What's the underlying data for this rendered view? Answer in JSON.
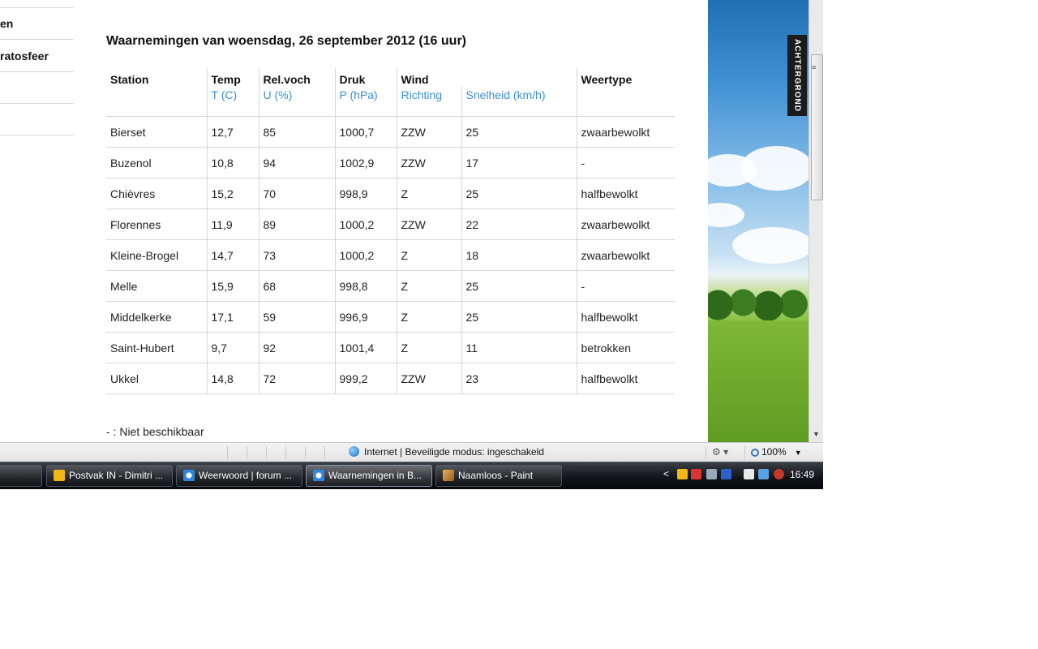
{
  "nav": {
    "items": [
      {
        "label": "en"
      },
      {
        "label": "ratosfeer"
      }
    ]
  },
  "observations": {
    "title": "Waarnemingen van woensdag, 26 september 2012 (16 uur)",
    "headers": {
      "station": "Station",
      "temp": "Temp",
      "temp_unit": "T (C)",
      "humidity": "Rel.voch",
      "humidity_unit": "U (%)",
      "pressure": "Druk",
      "pressure_unit": "P (hPa)",
      "wind": "Wind",
      "wind_dir": "Richting",
      "wind_speed": "Snelheid (km/h)",
      "weather": "Weertype"
    },
    "rows": [
      {
        "station": "Bierset",
        "temp": "12,7",
        "humidity": "85",
        "pressure": "1000,7",
        "direction": "ZZW",
        "speed": "25",
        "weather": "zwaarbewolkt"
      },
      {
        "station": "Buzenol",
        "temp": "10,8",
        "humidity": "94",
        "pressure": "1002,9",
        "direction": "ZZW",
        "speed": "17",
        "weather": "-"
      },
      {
        "station": "Chièvres",
        "temp": "15,2",
        "humidity": "70",
        "pressure": "998,9",
        "direction": "Z",
        "speed": "25",
        "weather": "halfbewolkt"
      },
      {
        "station": "Florennes",
        "temp": "11,9",
        "humidity": "89",
        "pressure": "1000,2",
        "direction": "ZZW",
        "speed": "22",
        "weather": "zwaarbewolkt"
      },
      {
        "station": "Kleine-Brogel",
        "temp": "14,7",
        "humidity": "73",
        "pressure": "1000,2",
        "direction": "Z",
        "speed": "18",
        "weather": "zwaarbewolkt"
      },
      {
        "station": "Melle",
        "temp": "15,9",
        "humidity": "68",
        "pressure": "998,8",
        "direction": "Z",
        "speed": "25",
        "weather": "-"
      },
      {
        "station": "Middelkerke",
        "temp": "17,1",
        "humidity": "59",
        "pressure": "996,9",
        "direction": "Z",
        "speed": "25",
        "weather": "halfbewolkt"
      },
      {
        "station": "Saint-Hubert",
        "temp": "9,7",
        "humidity": "92",
        "pressure": "1001,4",
        "direction": "Z",
        "speed": "11",
        "weather": "betrokken"
      },
      {
        "station": "Ukkel",
        "temp": "14,8",
        "humidity": "72",
        "pressure": "999,2",
        "direction": "ZZW",
        "speed": "23",
        "weather": "halfbewolkt"
      }
    ],
    "note": "- : Niet beschikbaar"
  },
  "background_tab": {
    "label": "ACHTERGROND"
  },
  "statusbar": {
    "zone": "Internet | Beveiligde modus: ingeschakeld",
    "zoom": "100%"
  },
  "taskbar": {
    "tasks": [
      {
        "label": "Postvak IN - Dimitri ...",
        "icon": "outlook-icon"
      },
      {
        "label": "Weerwoord | forum ...",
        "icon": "internet-explorer-icon"
      },
      {
        "label": "Waarnemingen in B...",
        "icon": "internet-explorer-icon",
        "active": true
      },
      {
        "label": "Naamloos - Paint",
        "icon": "paint-icon"
      }
    ],
    "clock": "16:49"
  },
  "colors": {
    "accent_blue": "#3b8fd0",
    "grid_line": "#d6d6d6",
    "taskbar": "#111418"
  }
}
